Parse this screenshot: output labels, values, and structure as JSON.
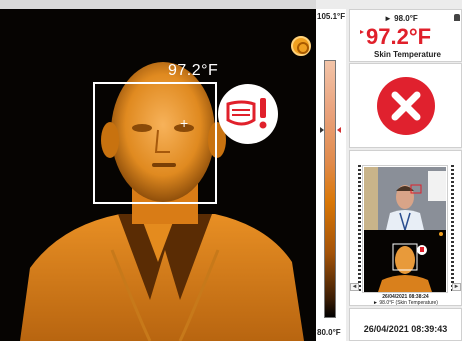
{
  "feed": {
    "temperature_overlay": "97.2°F",
    "crosshair": "+",
    "mask_alert_icon": "mask-warning-icon",
    "settings_icon": "gear-icon"
  },
  "scale": {
    "max_label": "105.1°F",
    "min_label": "80.0°F"
  },
  "reading": {
    "current": "► 98.0°F",
    "value": "97.2°F",
    "label": "Skin Temperature",
    "accent_color": "#e0202b"
  },
  "status": {
    "icon": "close-icon",
    "color": "#e0212e"
  },
  "snapshot": {
    "date": "26/04/2021 08:38:24",
    "caption": "► 98.0°F (Skin Temperature)",
    "prev_button": "◄",
    "next_button": "►"
  },
  "clock": {
    "datetime": "26/04/2021 08:39:43"
  }
}
